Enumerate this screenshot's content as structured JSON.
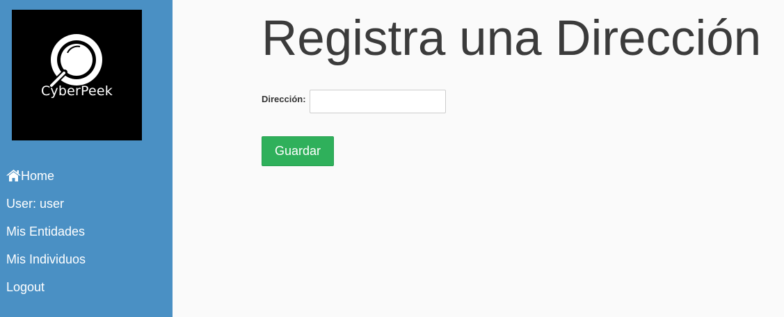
{
  "brand": {
    "name": "CyberPeek",
    "icon": "magnifier-icon"
  },
  "sidebar": {
    "items": [
      {
        "label": "Home",
        "icon": "home-icon"
      },
      {
        "label": "User: user"
      },
      {
        "label": "Mis Entidades"
      },
      {
        "label": "Mis Individuos"
      },
      {
        "label": "Logout"
      }
    ]
  },
  "main": {
    "title": "Registra una Dirección",
    "form": {
      "address_label": "Dirección:",
      "address_value": "",
      "save_label": "Guardar"
    }
  },
  "colors": {
    "sidebar_bg": "#4a90c4",
    "page_bg": "#fafafa",
    "logo_bg": "#000000",
    "button_bg": "#2fb05b",
    "title_text": "#3b3b3b"
  }
}
